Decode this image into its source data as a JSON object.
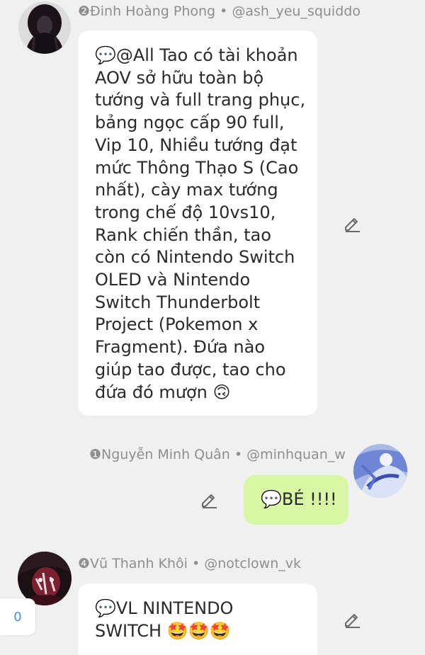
{
  "messages": [
    {
      "sender_line": "❷Đinh Hoàng Phong • @ash_yeu_squiddo",
      "text_lines": [
        "💬@All Tao có tài khoản",
        "AOV sở hữu toàn bộ",
        "tướng và full trang phục,",
        "bảng ngọc cấp 90 full,",
        "Vip 10, Nhiều tướng đạt",
        "mức Thông Thạo S (Cao",
        "nhất), cày max tướng",
        "trong chế độ 10vs10,",
        "Rank chiến thần, tao",
        "còn có Nintendo Switch",
        "OLED và Nintendo",
        "Switch Thunderbolt",
        "Project (Pokemon x",
        "Fragment).  Đứa nào",
        "giúp tao được, tao cho",
        "đứa đó mượn 🙃"
      ]
    },
    {
      "sender_line": "❶Nguyễn Minh Quân • @minhquan_w",
      "text_lines": [
        "💬BÉ !!!!"
      ]
    },
    {
      "sender_line": "❹Vũ Thanh Khôi • @notclown_vk",
      "text_lines": [
        "💬VL NINTENDO",
        "SWITCH 🤩🤩🤩"
      ]
    }
  ],
  "side_badge": {
    "count": "0"
  },
  "icons": {
    "edit": "pencil-edit-icon",
    "avatar_1": "dark-haired-girl-avatar",
    "avatar_2": "blue-anime-avatar",
    "avatar_3": "dark-red-anime-avatar"
  },
  "colors": {
    "background": "#f0f0f0",
    "bubble_received": "#ffffff",
    "bubble_sent": "#d9f6a4",
    "name_text": "#8e8e8e",
    "badge_text": "#4a8fe0"
  }
}
